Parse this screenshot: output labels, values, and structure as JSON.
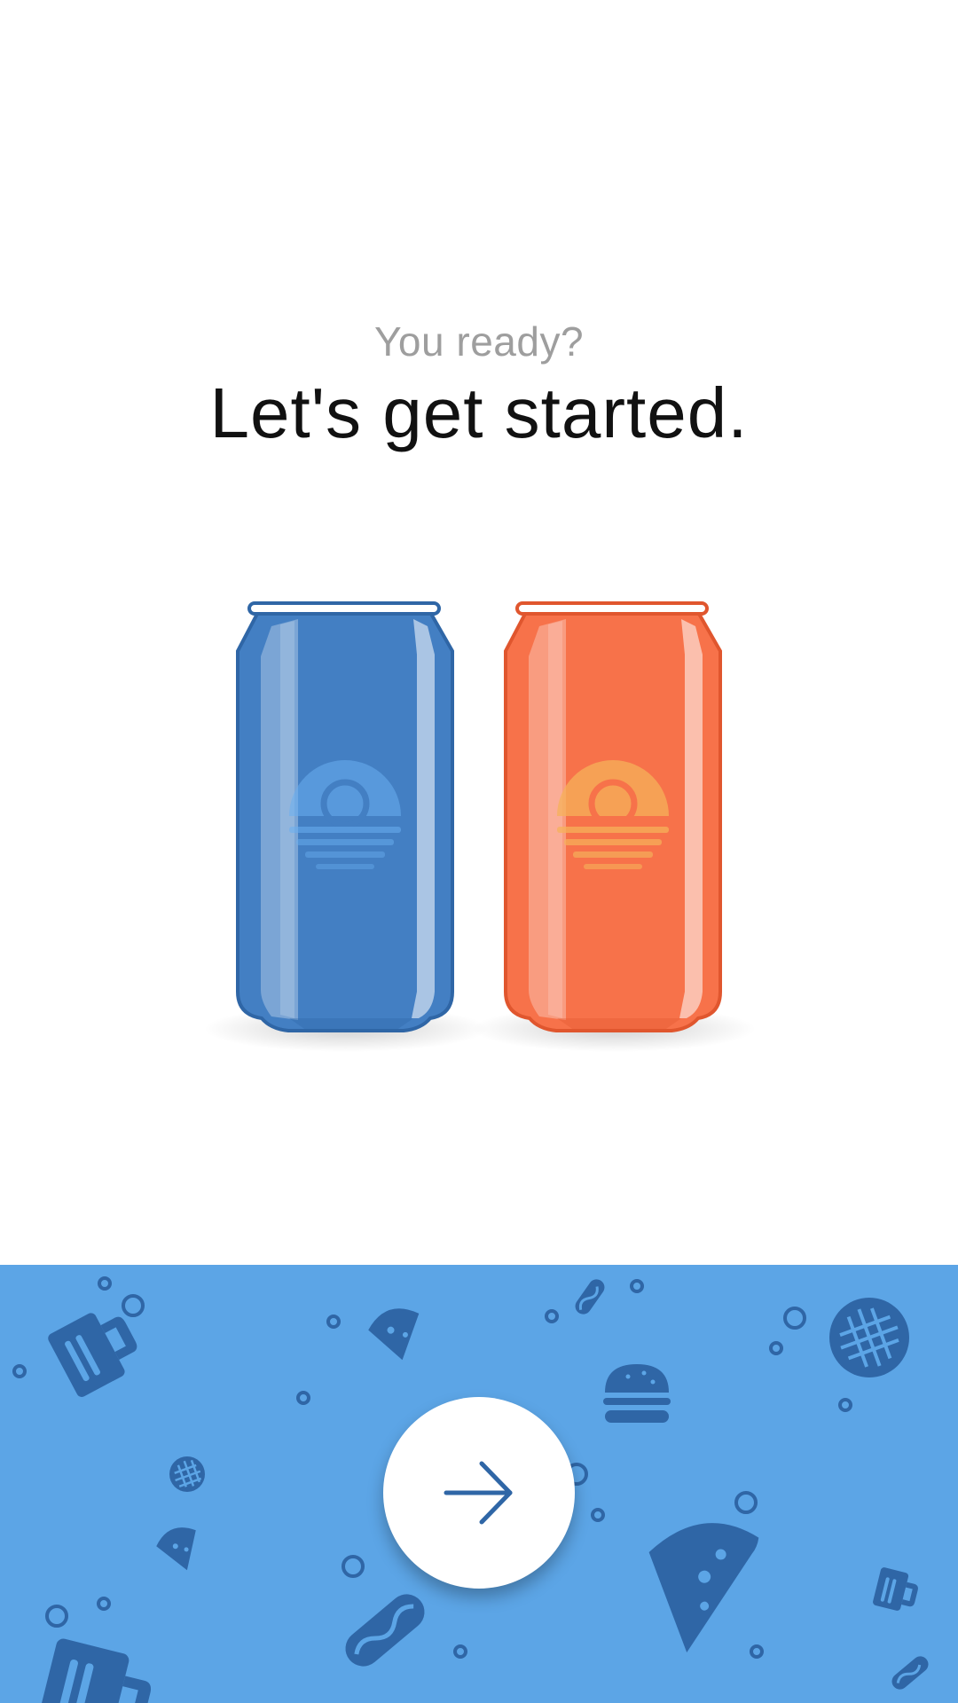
{
  "onboarding": {
    "subtitle": "You ready?",
    "headline": "Let's get started."
  },
  "illustration": {
    "left_can_color": "#437fc3",
    "right_can_color": "#f7724a"
  },
  "bottom_panel": {
    "background": "#5ca5e6",
    "pattern_color": "#2f66a6",
    "next_button_icon": "arrow-right-icon"
  }
}
